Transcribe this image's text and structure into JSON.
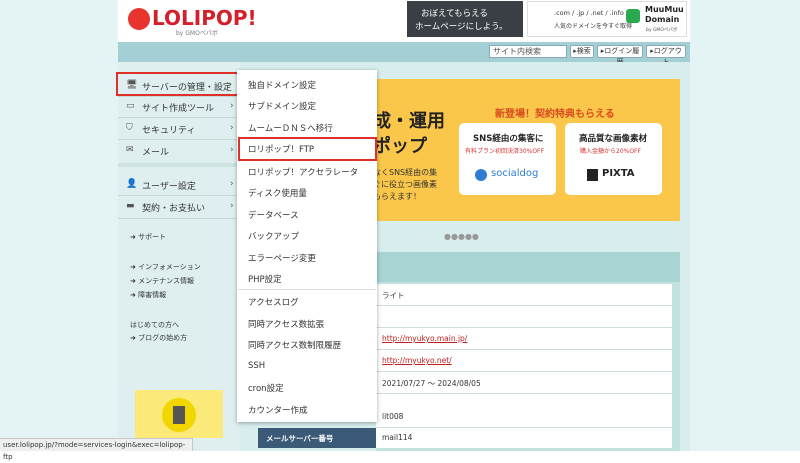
{
  "header": {
    "logo_text": "LOLIPOP!",
    "logo_sub": "by GMOペパボ",
    "banner1": {
      "line1": "おぼえてもらえる",
      "line2": "ホームページにしよう。"
    },
    "banner2": {
      "line1": ".com / .jp / .net / .info",
      "line2": "人気のドメインを今すぐ取得",
      "brand1": "MuuMuu",
      "brand2": "Domain",
      "brand_sub": "by GMOペパボ"
    }
  },
  "topbar": {
    "search_placeholder": "サイト内検索",
    "search_button": "▸検索",
    "history_button": "▸ログイン履歴",
    "logout_button": "▸ログアウト"
  },
  "sidebar": {
    "items": [
      {
        "icon": "server-icon",
        "glyph": "🖥",
        "label": "サーバーの管理・設定"
      },
      {
        "icon": "monitor-icon",
        "glyph": "▭",
        "label": "サイト作成ツール"
      },
      {
        "icon": "shield-icon",
        "glyph": "⛉",
        "label": "セキュリティ"
      },
      {
        "icon": "mail-icon",
        "glyph": "✉",
        "label": "メール"
      },
      {
        "icon": "user-icon",
        "glyph": "👤",
        "label": "ユーザー設定"
      },
      {
        "icon": "card-icon",
        "glyph": "▬",
        "label": "契約・お支払い"
      }
    ],
    "links1": [
      "サポート"
    ],
    "links2": [
      "インフォメーション",
      "メンテナンス情報",
      "障害情報"
    ],
    "heading3": "はじめての方へ",
    "links3": [
      "ブログの始め方"
    ]
  },
  "dropdown": {
    "items": [
      "独自ドメイン設定",
      "サブドメイン設定",
      "ムームーＤＮＳへ移行",
      "ロリポップ！FTP",
      "ロリポップ！アクセラレータ",
      "ディスク使用量",
      "データベース",
      "バックアップ",
      "エラーページ変更",
      "PHP設定",
      "アクセスログ",
      "同時アクセス数拡張",
      "同時アクセス数制限履歴",
      "SSH",
      "cron設定",
      "カウンター作成"
    ],
    "highlighted_index": 3
  },
  "promo": {
    "headline1": "成・運用",
    "headline2": "ポップ",
    "body1": "なくSNS経由の集",
    "body2": "ぐに役立つ画像素",
    "body3": "もらえます！",
    "badge": "新登場！契約特典もらえる",
    "card1": {
      "title": "SNS経由の集客に",
      "sub": "有料プラン初回決済30%OFF",
      "brand": "socialdog"
    },
    "card2": {
      "title": "高品質な画像素材",
      "sub": "購入金額から20%OFF",
      "brand": "PIXTA"
    },
    "dots": "●●●●●"
  },
  "table": {
    "rows": [
      "ライト",
      "",
      "http://myukyo.main.jp/",
      "http://myukyo.net/",
      "2021/07/27 ～ 2024/08/05",
      "",
      "lit008"
    ],
    "last_label": "メールサーバー番号",
    "last_value": "mail114"
  },
  "status_url": "user.lolipop.jp/?mode=services-login&exec=lolipop-ftp",
  "colors": {
    "accent_red": "#e0302a",
    "topbar": "#a3cfd5",
    "promo": "#fbc74a"
  }
}
